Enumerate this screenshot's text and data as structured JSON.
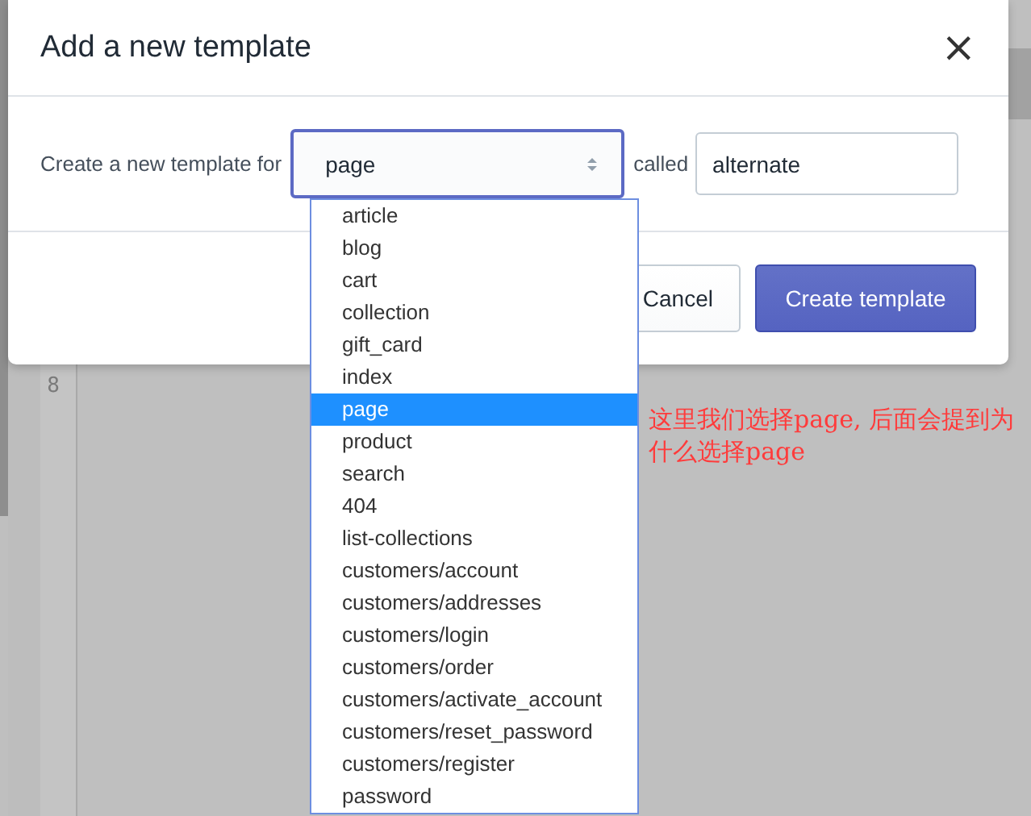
{
  "editor": {
    "lines": [
      {
        "number": "8"
      }
    ]
  },
  "modal": {
    "title": "Add a new template",
    "close": "×",
    "form": {
      "label": "Create a new template for",
      "select": {
        "value": "page",
        "expanded": true
      },
      "connector": "called",
      "name_field": {
        "value": "alternate"
      }
    },
    "buttons": [
      {
        "label": "Cancel",
        "kind": "secondary"
      },
      {
        "label": "Create template",
        "kind": "primary"
      }
    ]
  },
  "dropdown": {
    "options": [
      {
        "label": "article",
        "selected": false
      },
      {
        "label": "blog",
        "selected": false
      },
      {
        "label": "cart",
        "selected": false
      },
      {
        "label": "collection",
        "selected": false
      },
      {
        "label": "gift_card",
        "selected": false
      },
      {
        "label": "index",
        "selected": false
      },
      {
        "label": "page",
        "selected": true
      },
      {
        "label": "product",
        "selected": false
      },
      {
        "label": "search",
        "selected": false
      },
      {
        "label": "404",
        "selected": false
      },
      {
        "label": "list-collections",
        "selected": false
      },
      {
        "label": "customers/account",
        "selected": false
      },
      {
        "label": "customers/addresses",
        "selected": false
      },
      {
        "label": "customers/login",
        "selected": false
      },
      {
        "label": "customers/order",
        "selected": false
      },
      {
        "label": "customers/activate_account",
        "selected": false
      },
      {
        "label": "customers/reset_password",
        "selected": false
      },
      {
        "label": "customers/register",
        "selected": false
      },
      {
        "label": "password",
        "selected": false
      }
    ]
  },
  "annotation": {
    "text": "这里我们选择page, 后面会提到为什么选择page"
  }
}
